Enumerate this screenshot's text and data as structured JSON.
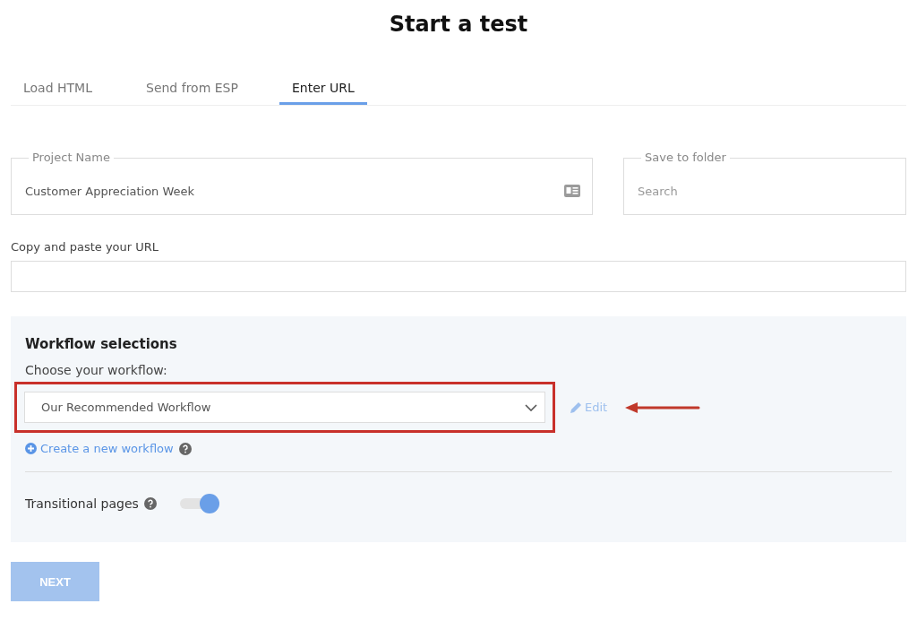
{
  "title": "Start a test",
  "tabs": [
    {
      "label": "Load HTML",
      "selected": false
    },
    {
      "label": "Send from ESP",
      "selected": false
    },
    {
      "label": "Enter URL",
      "selected": true
    }
  ],
  "project_name": {
    "label": "Project Name",
    "value": "Customer Appreciation Week"
  },
  "save_to_folder": {
    "label": "Save to folder",
    "placeholder": "Search"
  },
  "url": {
    "label": "Copy and paste your URL"
  },
  "workflow": {
    "heading": "Workflow selections",
    "label": "Choose your workflow:",
    "value": "Our Recommended Workflow",
    "edit": "Edit",
    "create": "Create a new workflow"
  },
  "transitional": {
    "label": "Transitional pages",
    "on": true
  },
  "next": {
    "label": "NEXT",
    "disabled": true
  }
}
